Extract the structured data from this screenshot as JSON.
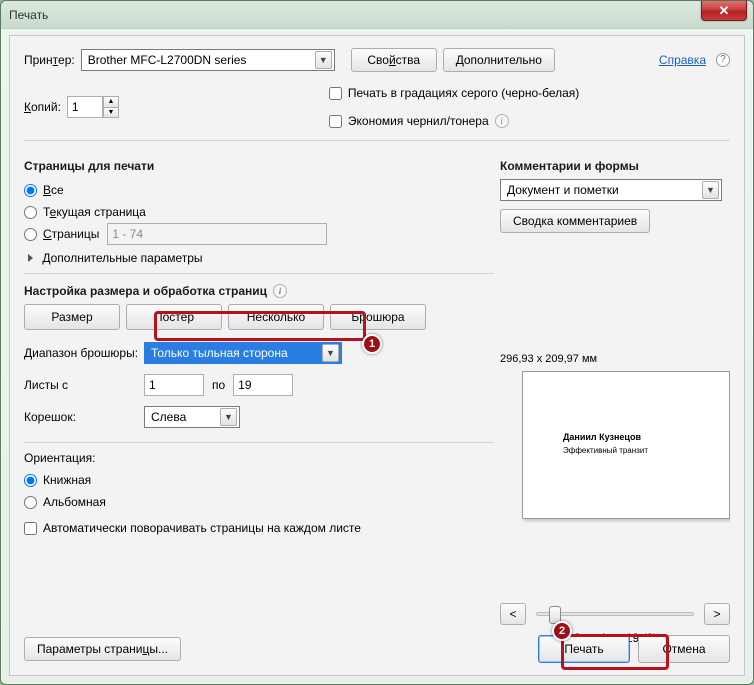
{
  "window": {
    "title": "Печать"
  },
  "header": {
    "printer_label_pre": "Прин",
    "printer_label_u": "т",
    "printer_label_post": "ер:",
    "printer_value": "Brother MFC-L2700DN series",
    "properties_pre": "Сво",
    "properties_u": "й",
    "properties_post": "ства",
    "advanced_pre": "",
    "advanced_u": "Д",
    "advanced_post": "ополнительно",
    "help_text": "Справка",
    "copies_pre": "",
    "copies_u": "К",
    "copies_post": "опий:",
    "copies_value": "1",
    "grayscale_label": "Печать в градациях серого (черно-белая)",
    "ink_save_label": "Экономия чернил/тонера"
  },
  "pages": {
    "title": "Страницы для печати",
    "all_pre": "",
    "all_u": "В",
    "all_post": "се",
    "current_pre": "Т",
    "current_u": "е",
    "current_post": "кущая страница",
    "range_pre": "",
    "range_u": "С",
    "range_post": "траницы",
    "range_value": "1 - 74",
    "more_params": "Дополнительные параметры"
  },
  "sizing": {
    "title": "Настройка размера и обработка страниц",
    "tab_size": "Размер",
    "tab_poster": "Постер",
    "tab_multiple": "Несколько",
    "tab_booklet": "Брошюра",
    "booklet_range_label": "Диапазон брошюры:",
    "booklet_range_value": "Только тыльная сторона",
    "sheets_from_label": "Листы с",
    "sheets_from": "1",
    "sheets_to_label": "по",
    "sheets_to": "19",
    "binding_label": "Корешок:",
    "binding_value": "Слева"
  },
  "orientation": {
    "title": "Ориентация:",
    "portrait": "Книжная",
    "landscape": "Альбомная",
    "autorotate": "Автоматически поворачивать страницы на каждом листе"
  },
  "comments": {
    "title": "Комментарии и формы",
    "dropdown_value": "Документ и пометки",
    "summary_btn": "Сводка комментариев"
  },
  "preview": {
    "dimensions": "296,93 x 209,97 мм",
    "doc_line1": "Даниил Кузнецов",
    "doc_line2": "Эффективный транзит",
    "page_status": "Стр. 1 из 19 (2)"
  },
  "footer": {
    "page_setup_pre": "Параметры страни",
    "page_setup_u": "ц",
    "page_setup_post": "ы...",
    "print_btn": "Печать",
    "cancel_btn": "Отмена"
  },
  "annotations": {
    "badge1": "1",
    "badge2": "2"
  }
}
